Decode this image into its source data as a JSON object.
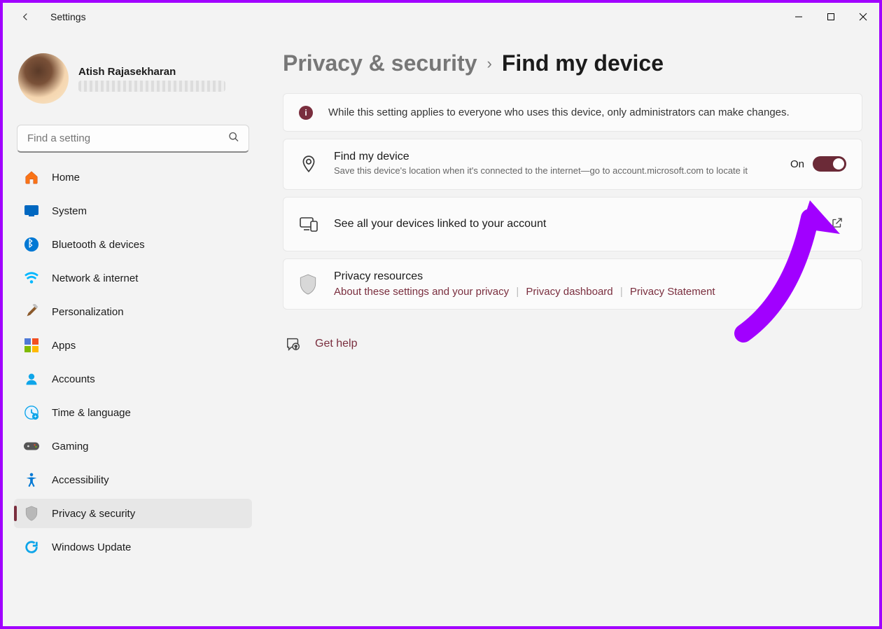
{
  "app_title": "Settings",
  "user": {
    "name": "Atish Rajasekharan"
  },
  "search": {
    "placeholder": "Find a setting"
  },
  "sidebar": {
    "items": [
      {
        "label": "Home",
        "icon": "home-icon"
      },
      {
        "label": "System",
        "icon": "system-icon"
      },
      {
        "label": "Bluetooth & devices",
        "icon": "bluetooth-icon"
      },
      {
        "label": "Network & internet",
        "icon": "wifi-icon"
      },
      {
        "label": "Personalization",
        "icon": "brush-icon"
      },
      {
        "label": "Apps",
        "icon": "apps-icon"
      },
      {
        "label": "Accounts",
        "icon": "accounts-icon"
      },
      {
        "label": "Time & language",
        "icon": "clock-icon"
      },
      {
        "label": "Gaming",
        "icon": "gaming-icon"
      },
      {
        "label": "Accessibility",
        "icon": "accessibility-icon"
      },
      {
        "label": "Privacy & security",
        "icon": "shield-icon",
        "active": true
      },
      {
        "label": "Windows Update",
        "icon": "update-icon"
      }
    ]
  },
  "breadcrumb": {
    "parent": "Privacy & security",
    "current": "Find my device"
  },
  "banner": {
    "text": "While this setting applies to everyone who uses this device, only administrators can make changes."
  },
  "find_my_device": {
    "title": "Find my device",
    "subtitle": "Save this device's location when it's connected to the internet—go to account.microsoft.com to locate it",
    "toggle_label": "On"
  },
  "devices_link": {
    "label": "See all your devices linked to your account"
  },
  "privacy": {
    "heading": "Privacy resources",
    "links": {
      "about": "About these settings and your privacy",
      "dashboard": "Privacy dashboard",
      "statement": "Privacy Statement"
    }
  },
  "help": {
    "label": "Get help"
  }
}
